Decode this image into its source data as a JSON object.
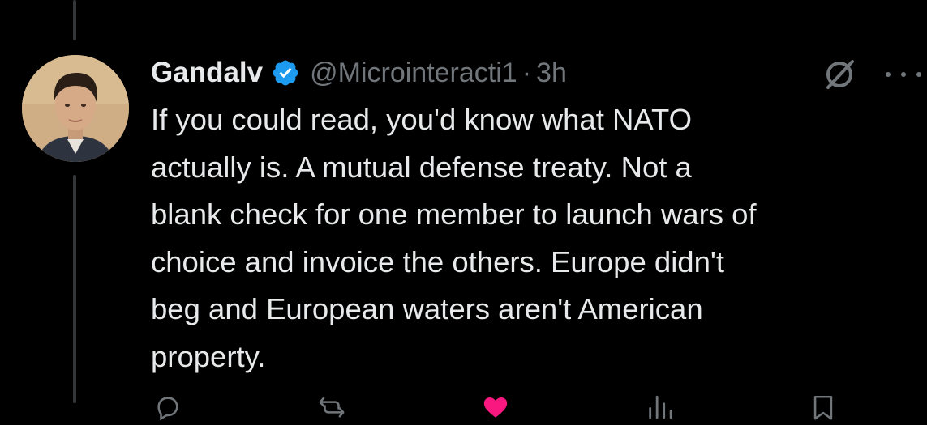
{
  "tweet": {
    "author": {
      "display_name": "Gandalv",
      "handle": "@Microinteracti1",
      "verified": true,
      "verified_color": "#1d9bf0"
    },
    "separator": "·",
    "time": "3h",
    "text": "If you could read, you'd know what NATO\nactually is. A mutual defense treaty. Not a\nblank check for one member to launch wars of\nchoice and invoice the others. Europe didn't\nbeg and European waters aren't American\nproperty.",
    "like_color": "#f91880"
  },
  "icons": {
    "grok": "grok-icon",
    "more": "more-icon",
    "reply": "reply-icon",
    "repost": "repost-icon",
    "like": "heart-icon",
    "views": "views-icon",
    "bookmark": "bookmark-icon"
  },
  "colors": {
    "background": "#000000",
    "text_primary": "#e7e9ea",
    "text_secondary": "#71767b",
    "thread_line": "#333639"
  }
}
